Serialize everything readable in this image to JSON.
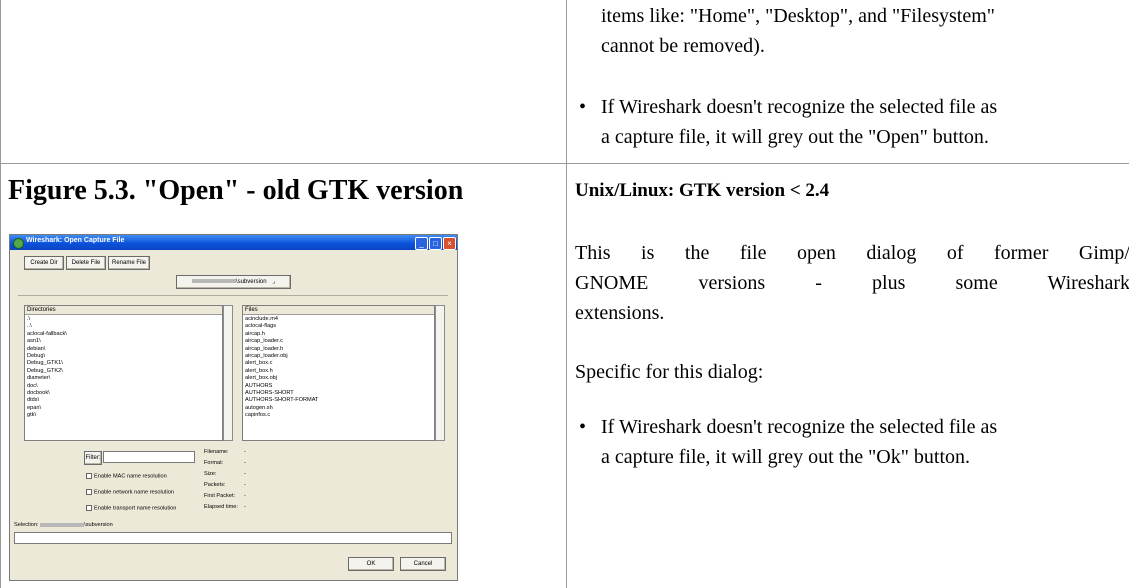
{
  "top_right": {
    "continuation_line_1": "items like: \"Home\", \"Desktop\", and \"Filesystem\"",
    "continuation_line_2": "cannot be removed).",
    "bullet_line_1": "If Wireshark doesn't recognize the selected file as",
    "bullet_line_2": "a capture file, it will grey out the \"Open\" button."
  },
  "figure": {
    "title": "Figure 5.3. \"Open\" - old GTK version"
  },
  "right_section": {
    "heading": "Unix/Linux: GTK version < 2.4",
    "para_line_1": "This is the file open dialog of former Gimp/",
    "para_line_2": "GNOME versions - plus some Wireshark",
    "para_line_3": "extensions.",
    "specific": "Specific for this dialog:",
    "bullet_line_1": "If Wireshark doesn't recognize the selected file as",
    "bullet_line_2": "a capture file, it will grey out the \"Ok\" button."
  },
  "bullet_glyph": "•",
  "dialog": {
    "title": "Wireshark: Open Capture File",
    "buttons": {
      "create_dir": "Create Dir",
      "delete_file": "Delete File",
      "rename_file": "Rename File"
    },
    "path_suffix": "\\subversion",
    "path_arrow": "⌟",
    "directories_header": "Directories",
    "directories": [
      ".\\",
      "..\\",
      "aclocal-fallback\\",
      "asn1\\",
      "debian\\",
      "Debug\\",
      "Debug_GTK1\\",
      "Debug_GTK2\\",
      "diameter\\",
      "doc\\",
      "docbook\\",
      "dtds\\",
      "epan\\",
      "gtk\\"
    ],
    "files_header": "Files",
    "files": [
      "acinclude.m4",
      "aclocal-flags",
      "aircap.h",
      "aircap_loader.c",
      "aircap_loader.h",
      "aircap_loader.obj",
      "alert_box.c",
      "alert_box.h",
      "alert_box.obj",
      "AUTHORS",
      "AUTHORS-SHORT",
      "AUTHORS-SHORT-FORMAT",
      "autogen.sh",
      "capinfos.c"
    ],
    "filter_button": "Filter:",
    "checkboxes": [
      "Enable MAC name resolution",
      "Enable network name resolution",
      "Enable transport name resolution"
    ],
    "info_labels": [
      "Filename:",
      "Format:",
      "Size:",
      "Packets:",
      "First Packet:",
      "Elapsed time:"
    ],
    "info_value": "-",
    "selection_label": "Selection:",
    "ok": "OK",
    "cancel": "Cancel",
    "titlebar_icons": [
      "minimize-icon",
      "maximize-icon",
      "close-icon"
    ]
  },
  "colors": {
    "grid": "#9a9a9a",
    "titlebar": "#0a4fd8",
    "dialog_bg": "#ece9d8"
  }
}
